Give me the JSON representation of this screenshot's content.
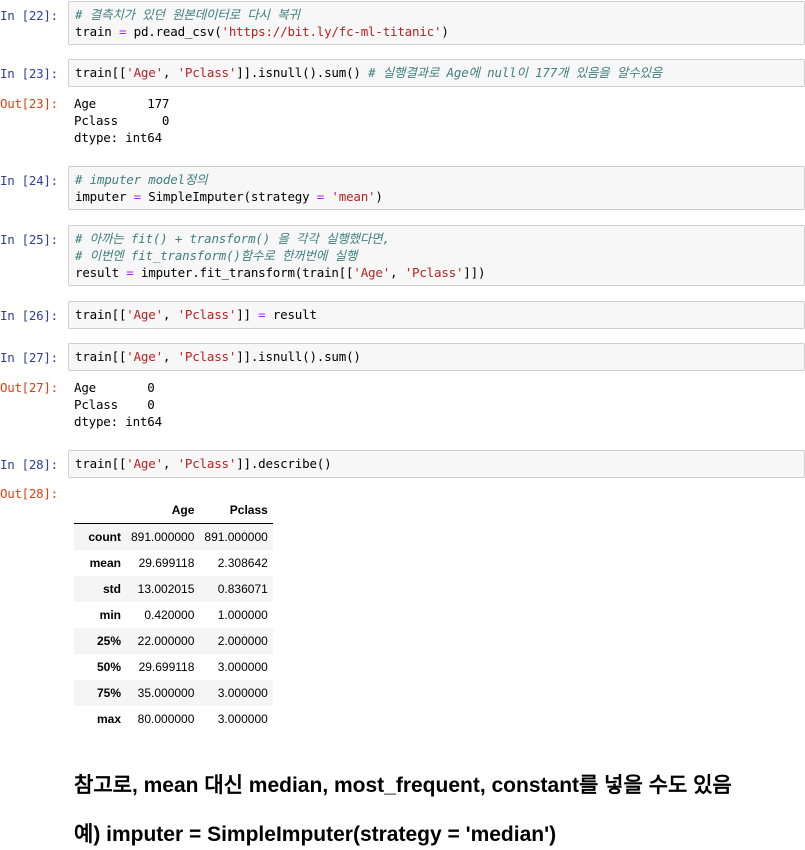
{
  "cells": {
    "c22": {
      "in": "In [22]:",
      "comment": "# 결측치가 있던 원본데이터로 다시 복귀",
      "l2a": "train ",
      "l2b": "=",
      "l2c": " pd.read_csv(",
      "l2d": "'https://bit.ly/fc-ml-titanic'",
      "l2e": ")"
    },
    "c23": {
      "in": "In [23]:",
      "a": "train[[",
      "b": "'Age'",
      "c": ", ",
      "d": "'Pclass'",
      "e": "]].isnull().sum() ",
      "comment": "# 실행결과로 Age에 null이 177개 있음을 알수있음",
      "out": "Out[23]:",
      "o1": "Age       177",
      "o2": "Pclass      0",
      "o3": "dtype: int64"
    },
    "c24": {
      "in": "In [24]:",
      "comment": "# imputer model정의",
      "a": "imputer ",
      "b": "=",
      "c": " SimpleImputer(strategy ",
      "d": "=",
      "e": " ",
      "f": "'mean'",
      "g": ")"
    },
    "c25": {
      "in": "In [25]:",
      "comment1": "# 아까는 fit() + transform() 을 각각 실행했다면,",
      "comment2": "# 이번엔 fit_transform()함수로 한꺼번에 실행",
      "a": "result ",
      "b": "=",
      "c": " imputer.fit_transform(train[[",
      "d": "'Age'",
      "e": ", ",
      "f": "'Pclass'",
      "g": "]])"
    },
    "c26": {
      "in": "In [26]:",
      "a": "train[[",
      "b": "'Age'",
      "c": ", ",
      "d": "'Pclass'",
      "e": "]] ",
      "f": "=",
      "g": " result"
    },
    "c27": {
      "in": "In [27]:",
      "a": "train[[",
      "b": "'Age'",
      "c": ", ",
      "d": "'Pclass'",
      "e": "]].isnull().sum()",
      "out": "Out[27]:",
      "o1": "Age       0",
      "o2": "Pclass    0",
      "o3": "dtype: int64"
    },
    "c28": {
      "in": "In [28]:",
      "a": "train[[",
      "b": "'Age'",
      "c": ", ",
      "d": "'Pclass'",
      "e": "]].describe()",
      "out": "Out[28]:"
    }
  },
  "describe_table": {
    "columns": [
      "",
      "Age",
      "Pclass"
    ],
    "rows": [
      [
        "count",
        "891.000000",
        "891.000000"
      ],
      [
        "mean",
        "29.699118",
        "2.308642"
      ],
      [
        "std",
        "13.002015",
        "0.836071"
      ],
      [
        "min",
        "0.420000",
        "1.000000"
      ],
      [
        "25%",
        "22.000000",
        "2.000000"
      ],
      [
        "50%",
        "29.699118",
        "3.000000"
      ],
      [
        "75%",
        "35.000000",
        "3.000000"
      ],
      [
        "max",
        "80.000000",
        "3.000000"
      ]
    ]
  },
  "notes": {
    "line1": "참고로, mean 대신 median, most_frequent, constant를 넣을 수도 있음",
    "line2": "예) imputer = SimpleImputer(strategy = 'median')"
  }
}
